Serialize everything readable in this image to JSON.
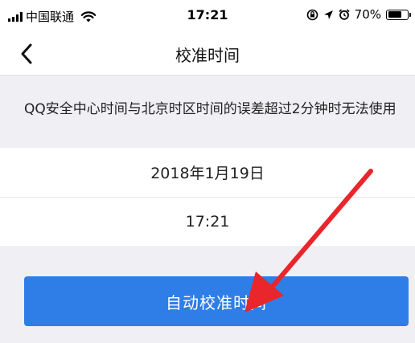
{
  "status_bar": {
    "carrier": "中国联通",
    "time": "17:21",
    "battery": "70%",
    "battery_level": 0.7,
    "icons": [
      "signal-icon",
      "wifi-icon",
      "rotation-lock-icon",
      "location-icon",
      "alarm-icon",
      "battery-icon"
    ]
  },
  "nav": {
    "title": "校准时间",
    "back_icon": "chevron-left-icon"
  },
  "notice": {
    "text": "QQ安全中心时间与北京时区时间的误差超过2分钟时无法使用"
  },
  "info": {
    "date": "2018年1月19日",
    "time": "17:21"
  },
  "action": {
    "label": "自动校准时间"
  },
  "colors": {
    "primary": "#2f7ee8",
    "background": "#efeff4",
    "annotation_arrow": "#e8262b"
  }
}
